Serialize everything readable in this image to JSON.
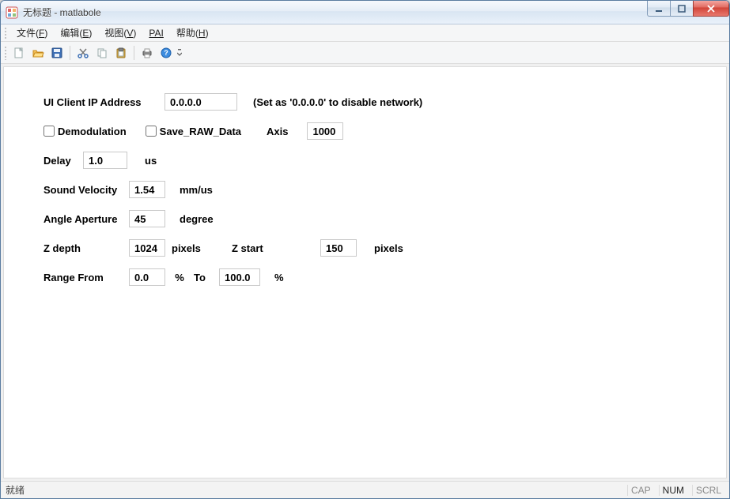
{
  "window": {
    "title": "无标题 - matlabole"
  },
  "menus": {
    "file": {
      "label": "文件",
      "mn": "F"
    },
    "edit": {
      "label": "编辑",
      "mn": "E"
    },
    "view": {
      "label": "视图",
      "mn": "V"
    },
    "pai": {
      "label": "PAI"
    },
    "help": {
      "label": "帮助",
      "mn": "H"
    }
  },
  "toolbar_icons": {
    "new": "new-file-icon",
    "open": "open-folder-icon",
    "save": "save-icon",
    "cut": "cut-icon",
    "copy": "copy-icon",
    "paste": "paste-icon",
    "print": "print-icon",
    "help": "help-icon"
  },
  "form": {
    "ip_label": "UI Client IP Address",
    "ip_value": "0.0.0.0",
    "ip_hint": "(Set as '0.0.0.0' to disable network)",
    "demod_label": "Demodulation",
    "demod_checked": false,
    "save_raw_label": "Save_RAW_Data",
    "save_raw_checked": false,
    "axis_label": "Axis",
    "axis_value": "1000",
    "delay_label": "Delay",
    "delay_value": "1.0",
    "delay_unit": "us",
    "sv_label": "Sound Velocity",
    "sv_value": "1.54",
    "sv_unit": "mm/us",
    "aa_label": "Angle Aperture",
    "aa_value": "45",
    "aa_unit": "degree",
    "zd_label": "Z depth",
    "zd_value": "1024",
    "zd_unit": "pixels",
    "zs_label": "Z start",
    "zs_value": "150",
    "zs_unit": "pixels",
    "rf_label": "Range From",
    "rf_value": "0.0",
    "rf_unit": "%",
    "rt_label": "To",
    "rt_value": "100.0",
    "rt_unit": "%"
  },
  "status": {
    "ready": "就绪",
    "cap": "CAP",
    "num": "NUM",
    "scrl": "SCRL"
  }
}
